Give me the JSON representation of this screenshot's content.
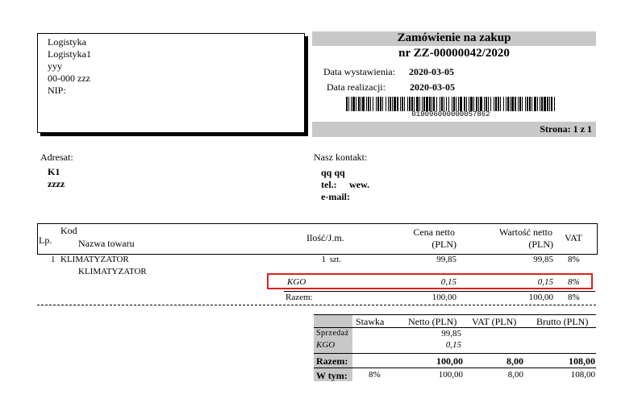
{
  "sender": {
    "lines": [
      "Logistyka",
      "Logistyka1",
      "yyy",
      "00-000 zzz",
      "NIP:"
    ]
  },
  "header": {
    "title": "Zamówienie na zakup",
    "number": "nr ZZ-00000042/2020",
    "issue_date_label": "Data wystawienia:",
    "issue_date": "2020-03-05",
    "realization_label": "Data realizacji:",
    "realization_date": "2020-03-05",
    "barcode_text": "010096000000057862",
    "page": "Strona: 1 z 1"
  },
  "addressee": {
    "label": "Adresat:",
    "name": "K1",
    "line2": "zzzz"
  },
  "contact": {
    "label": "Nasz kontakt:",
    "name": "qq qq",
    "tel": "tel.:",
    "wew": "wew.",
    "email": "e-mail:"
  },
  "table": {
    "col_lp": "Lp.",
    "col_kod": "Kod",
    "col_nazwa": "Nazwa towaru",
    "col_ilosc": "Ilość/J.m.",
    "col_cena_1": "Cena netto",
    "col_cena_2": "(PLN)",
    "col_wartosc_1": "Wartość netto",
    "col_wartosc_2": "(PLN)",
    "col_vat": "VAT",
    "rows": [
      {
        "lp": "1",
        "kod": "KLIMATYZATOR",
        "nazwa": "KLIMATYZATOR",
        "qty": "1",
        "unit": "szt.",
        "price": "99,85",
        "value": "99,85",
        "vat": "8%"
      }
    ],
    "kgo": {
      "label": "KGO",
      "price": "0,15",
      "value": "0,15",
      "vat": "8%"
    },
    "total": {
      "label": "Razem:",
      "price": "100,00",
      "value": "100,00",
      "vat": "8%"
    }
  },
  "summary": {
    "col_stawka": "Stawka",
    "col_netto": "Netto (PLN)",
    "col_vat": "VAT (PLN)",
    "col_brutto": "Brutto (PLN)",
    "sprzedaz_label": "Sprzedaż",
    "sprzedaz_netto": "99,85",
    "kgo_label": "KGO",
    "kgo_netto": "0,15",
    "razem_label": "Razem:",
    "razem_netto": "100,00",
    "razem_vat": "8,00",
    "razem_brutto": "108,00",
    "wtym_label": "W tym:",
    "wtym_stawka": "8%",
    "wtym_netto": "100,00",
    "wtym_vat": "8,00",
    "wtym_brutto": "108,00"
  }
}
